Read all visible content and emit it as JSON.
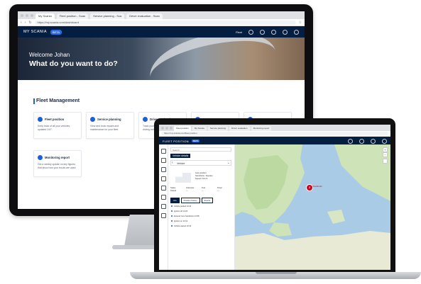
{
  "desktop": {
    "browser": {
      "tabs": [
        "My Scania",
        "Fleet position - Scan",
        "Service planning - Sca",
        "Driver evaluation - Scan"
      ],
      "url": "https://my.scania.com/dashboard"
    },
    "header": {
      "brand": "MY SCANIA",
      "badge": "BETA",
      "user_label": "Fleet"
    },
    "hero": {
      "welcome": "Welcome Johan",
      "title": "What do you want to do?"
    },
    "section_title": "Fleet Management",
    "cards": [
      {
        "title": "Fleet position",
        "desc": "Keep track of all your vehicles, updated 24/7."
      },
      {
        "title": "Service planning",
        "desc": "View and book repairs and maintenance for your fleet."
      },
      {
        "title": "Driver evaluation",
        "desc": "Track your drivers' performance and driving behaviour."
      },
      {
        "title": "",
        "desc": ""
      },
      {
        "title": "",
        "desc": ""
      },
      {
        "title": "Monitoring report",
        "desc": "Get a weekly update on key figures that show how your trucks are used."
      }
    ]
  },
  "laptop": {
    "browser": {
      "tabs": [
        "Fleet position",
        "My Scania",
        "Service planning",
        "Driver evaluation",
        "Monitoring report"
      ],
      "url": "https://my.scania.com/fleet-position"
    },
    "header": {
      "brand": "FLEET POSITION",
      "badge": "BETA"
    },
    "panel": {
      "search_placeholder": "Search",
      "section": "Vehicle details",
      "selected_vehicle": "Vehicle",
      "info_lines": [
        "Last position",
        "Stockholm, Sweden",
        "Speed 0 km/h"
      ],
      "stats": [
        {
          "label": "Status",
          "value": "Parked"
        },
        {
          "label": "Odometer",
          "value": "—"
        },
        {
          "label": "Fuel",
          "value": "—"
        },
        {
          "label": "Driver",
          "value": "—"
        }
      ],
      "tabs": [
        "Info",
        "Position history",
        "Events"
      ],
      "events": [
        "Vehicle parked 14:22",
        "Ignition off 14:20",
        "Entered zone Stockholm 13:58",
        "Ignition on 13:12",
        "Vehicle started 13:10"
      ]
    },
    "map": {
      "pin_count": "2",
      "pin_label": "Stockholm",
      "zoom_in": "+",
      "zoom_out": "−"
    }
  }
}
